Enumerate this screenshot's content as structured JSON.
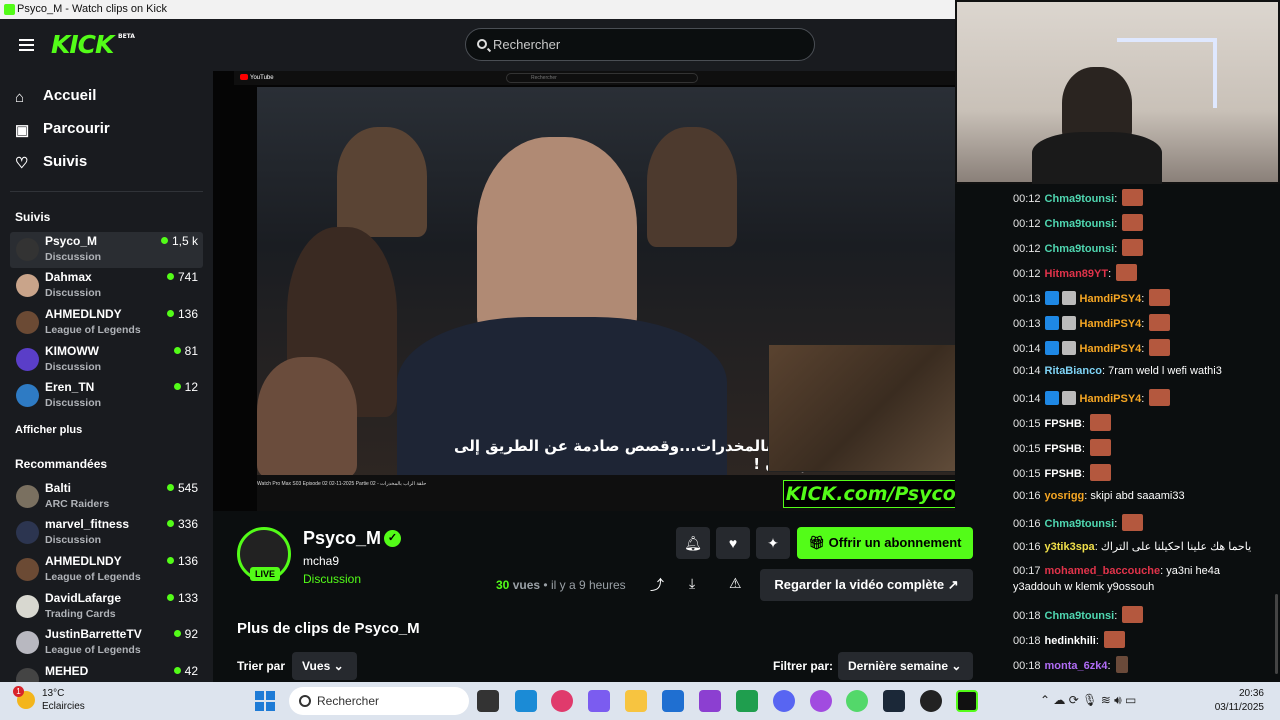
{
  "window": {
    "title": "Psyco_M - Watch clips on Kick"
  },
  "header": {
    "logo": "KICK",
    "beta": "BETA",
    "search_placeholder": "Rechercher"
  },
  "nav": [
    {
      "label": "Accueil",
      "icon": "home-icon"
    },
    {
      "label": "Parcourir",
      "icon": "browse-icon"
    },
    {
      "label": "Suivis",
      "icon": "heart-icon"
    }
  ],
  "followed": {
    "title": "Suivis",
    "items": [
      {
        "name": "Psyco_M",
        "category": "Discussion",
        "viewers": "1,5 k"
      },
      {
        "name": "Dahmax",
        "category": "Discussion",
        "viewers": "741"
      },
      {
        "name": "AHMEDLNDY",
        "category": "League of Legends",
        "viewers": "136"
      },
      {
        "name": "KIMOWW",
        "category": "Discussion",
        "viewers": "81"
      },
      {
        "name": "Eren_TN",
        "category": "Discussion",
        "viewers": "12"
      }
    ],
    "show_more": "Afficher plus"
  },
  "recommended": {
    "title": "Recommandées",
    "items": [
      {
        "name": "Balti",
        "category": "ARC Raiders",
        "viewers": "545"
      },
      {
        "name": "marvel_fitness",
        "category": "Discussion",
        "viewers": "336"
      },
      {
        "name": "AHMEDLNDY",
        "category": "League of Legends",
        "viewers": "136"
      },
      {
        "name": "DavidLafarge",
        "category": "Trading Cards",
        "viewers": "133"
      },
      {
        "name": "JustinBarretteTV",
        "category": "League of Legends",
        "viewers": "92"
      },
      {
        "name": "MEHED",
        "category": "",
        "viewers": "42"
      }
    ]
  },
  "video": {
    "yt_logo": "YouTube",
    "yt_search": "Rechercher",
    "subtitle": "الراب بالمخدرات...وقصص صادمة عن الطريق إلى الإدمان !",
    "yt_title": "Watch Pro Max S03 Episode 02 02-11-2025 Partie 02 - حلقة الراب بالمخدرات",
    "overlay": "KICK.com/Psyco_M"
  },
  "clip": {
    "channel": "Psyco_M",
    "verified": "✓",
    "title": "mcha9",
    "category": "Discussion",
    "live": "LIVE",
    "views_count": "30",
    "views_label": "vues",
    "time_ago": "• il y a 9 heures",
    "subscribe": "Offrir un abonnement",
    "watch_full": "Regarder la vidéo complète",
    "more_clips": "Plus de clips de Psyco_M",
    "sort_label": "Trier par",
    "sort_value": "Vues",
    "filter_label": "Filtrer par:",
    "filter_value": "Dernière semaine"
  },
  "chat": [
    {
      "time": "00:12",
      "user": "Chma9tounsi",
      "color": "#4fd6b0",
      "text": "",
      "emote": true,
      "badges": 0
    },
    {
      "time": "00:12",
      "user": "Chma9tounsi",
      "color": "#4fd6b0",
      "text": "",
      "emote": true,
      "badges": 0
    },
    {
      "time": "00:12",
      "user": "Chma9tounsi",
      "color": "#4fd6b0",
      "text": "",
      "emote": true,
      "badges": 0
    },
    {
      "time": "00:12",
      "user": "Hitman89YT",
      "color": "#e0334a",
      "text": "",
      "emote": true,
      "badges": 0
    },
    {
      "time": "00:13",
      "user": "HamdiPSY4",
      "color": "#f6a623",
      "text": "",
      "emote": true,
      "badges": 2
    },
    {
      "time": "00:13",
      "user": "HamdiPSY4",
      "color": "#f6a623",
      "text": "",
      "emote": true,
      "badges": 2
    },
    {
      "time": "00:14",
      "user": "HamdiPSY4",
      "color": "#f6a623",
      "text": "",
      "emote": true,
      "badges": 2
    },
    {
      "time": "00:14",
      "user": "RitaBianco",
      "color": "#7fd3f5",
      "text": "7ram weld l wefi wathi3",
      "emote": false,
      "badges": 0
    },
    {
      "time": "00:14",
      "user": "HamdiPSY4",
      "color": "#f6a623",
      "text": "",
      "emote": true,
      "badges": 2
    },
    {
      "time": "00:15",
      "user": "FPSHB",
      "color": "#ffffff",
      "text": "",
      "emote": true,
      "badges": 0
    },
    {
      "time": "00:15",
      "user": "FPSHB",
      "color": "#ffffff",
      "text": "",
      "emote": true,
      "badges": 0
    },
    {
      "time": "00:15",
      "user": "FPSHB",
      "color": "#ffffff",
      "text": "",
      "emote": true,
      "badges": 0
    },
    {
      "time": "00:16",
      "user": "yosrigg",
      "color": "#f6a623",
      "text": "skipi abd saaami33",
      "emote": false,
      "badges": 0
    },
    {
      "time": "00:16",
      "user": "Chma9tounsi",
      "color": "#4fd6b0",
      "text": "",
      "emote": true,
      "badges": 0
    },
    {
      "time": "00:16",
      "user": "y3tik3spa",
      "color": "#f1e04a",
      "text": "ياحما هك علينا احكيلنا على التراك",
      "emote": false,
      "badges": 0
    },
    {
      "time": "00:17",
      "user": "mohamed_baccouche",
      "color": "#e0334a",
      "text": "ya3ni he4a",
      "emote": false,
      "badges": 0
    },
    {
      "time": "",
      "user": "",
      "color": "#ffffff",
      "text": "y3addouh w klemk y9ossouh",
      "emote": false,
      "badges": 0
    },
    {
      "time": "00:18",
      "user": "Chma9tounsi",
      "color": "#4fd6b0",
      "text": "",
      "emote": true,
      "badges": 0
    },
    {
      "time": "00:18",
      "user": "hedinkhili",
      "color": "#ffffff",
      "text": "",
      "emote": true,
      "badges": 0
    },
    {
      "time": "00:18",
      "user": "monta_6zk4",
      "color": "#b06cf5",
      "text": "",
      "emote": true,
      "badges": 0
    }
  ],
  "taskbar": {
    "temp": "13°C",
    "weather": "Eclaircies",
    "search": "Rechercher",
    "time": "20:36",
    "date": "03/11/2025"
  },
  "colors": {
    "accent": "#53fc18",
    "sidebar": "#191b1f",
    "background": "#0b0e0f"
  }
}
